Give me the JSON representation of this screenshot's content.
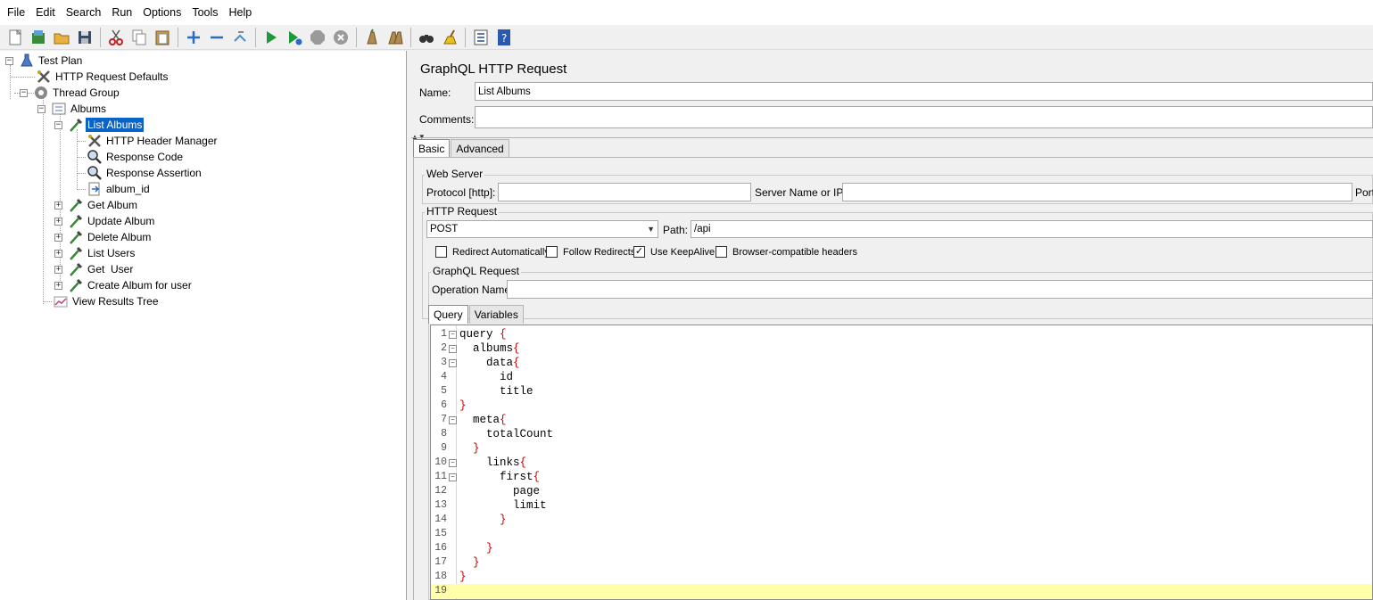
{
  "menu": [
    "File",
    "Edit",
    "Search",
    "Run",
    "Options",
    "Tools",
    "Help"
  ],
  "toolbar": [
    {
      "name": "new-icon",
      "group": 0
    },
    {
      "name": "templates-icon",
      "group": 0
    },
    {
      "name": "open-icon",
      "group": 0
    },
    {
      "name": "save-icon",
      "group": 0
    },
    {
      "name": "cut-icon",
      "group": 1
    },
    {
      "name": "copy-icon",
      "group": 1
    },
    {
      "name": "paste-icon",
      "group": 1
    },
    {
      "name": "expand-icon",
      "group": 2
    },
    {
      "name": "collapse-icon",
      "group": 2
    },
    {
      "name": "toggle-icon",
      "group": 2
    },
    {
      "name": "start-icon",
      "group": 3
    },
    {
      "name": "start-no-pauses-icon",
      "group": 3
    },
    {
      "name": "stop-icon",
      "group": 3
    },
    {
      "name": "shutdown-icon",
      "group": 3
    },
    {
      "name": "clear-icon",
      "group": 4
    },
    {
      "name": "clear-all-icon",
      "group": 4
    },
    {
      "name": "search-icon",
      "group": 5
    },
    {
      "name": "reset-search-icon",
      "group": 5
    },
    {
      "name": "function-helper-icon",
      "group": 6
    },
    {
      "name": "help-icon",
      "group": 6
    }
  ],
  "tree": {
    "test_plan": "Test Plan",
    "http_request_defaults": "HTTP Request Defaults",
    "thread_group": "Thread Group",
    "albums": "Albums",
    "list_albums": "List Albums",
    "http_header_manager": "HTTP Header Manager",
    "response_code": "Response Code",
    "response_assertion": "Response Assertion",
    "album_id": "album_id",
    "get_album": "Get Album",
    "update_album": "Update Album",
    "delete_album": "Delete Album",
    "list_users": "List Users",
    "get_user": "Get  User",
    "create_album_for_user": "Create Album for user",
    "view_results_tree": "View Results Tree"
  },
  "panel": {
    "title": "GraphQL HTTP Request",
    "name_label": "Name:",
    "name_value": "List Albums",
    "comments_label": "Comments:",
    "comments_value": "",
    "tabs": [
      "Basic",
      "Advanced"
    ],
    "web_server": {
      "title": "Web Server",
      "protocol_label": "Protocol [http]:",
      "protocol_value": "",
      "server_label": "Server Name or IP:",
      "server_value": "",
      "port_label": "Port"
    },
    "http_request": {
      "title": "HTTP Request",
      "method": "POST",
      "path_label": "Path:",
      "path_value": "/api",
      "redirect_auto": "Redirect Automatically",
      "follow_redirects": "Follow Redirects",
      "use_keepalive": "Use KeepAlive",
      "browser_headers": "Browser-compatible headers"
    },
    "graphql": {
      "title": "GraphQL Request",
      "operation_label": "Operation Name",
      "operation_value": "",
      "tabs": [
        "Query",
        "Variables"
      ]
    }
  },
  "code_lines": [
    "query {",
    "  albums{",
    "    data{",
    "      id",
    "      title",
    "}",
    "  meta{",
    "    totalCount",
    "  }",
    "    links{",
    "      first{",
    "        page",
    "        limit",
    "      }",
    "",
    "    }",
    "  }",
    "}",
    ""
  ]
}
